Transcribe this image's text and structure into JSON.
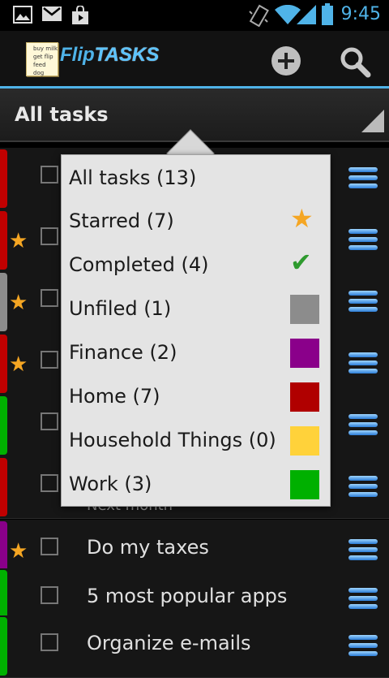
{
  "status_bar": {
    "time": "9:45",
    "icons": [
      "gallery-icon",
      "gmail-icon",
      "market-icon",
      "vibrate-icon",
      "wifi-icon",
      "signal-icon",
      "battery-icon"
    ]
  },
  "app_bar": {
    "logo_flip": "Flip",
    "logo_tasks": "TASKS",
    "logo_note_lines": [
      "buy milk",
      "get flip",
      "feed dog"
    ],
    "add_icon": "add-icon",
    "search_icon": "search-icon"
  },
  "filter_bar": {
    "title": "All tasks"
  },
  "rows": [
    {
      "bar_color": "#c00000",
      "starred": false,
      "title": ""
    },
    {
      "bar_color": "#c00000",
      "starred": true,
      "title": ""
    },
    {
      "bar_color": "#8c8c8c",
      "starred": true,
      "title": ""
    },
    {
      "bar_color": "#c00000",
      "starred": true,
      "title": ""
    },
    {
      "bar_color": "#00b000",
      "starred": false,
      "title": ""
    },
    {
      "bar_color": "#c00000",
      "starred": false,
      "title": ""
    },
    {
      "bar_color": "#8a008a",
      "starred": true,
      "title": "Do my taxes"
    },
    {
      "bar_color": "#00b000",
      "starred": false,
      "title": "5 most popular apps"
    },
    {
      "bar_color": "#00b000",
      "starred": false,
      "title": "Organize e-mails"
    }
  ],
  "hidden_text": "Next month",
  "popup": {
    "items": [
      {
        "label": "All tasks (13)",
        "kind": "none"
      },
      {
        "label": "Starred (7)",
        "kind": "star",
        "icon": "star-icon",
        "color": "#f5a623"
      },
      {
        "label": "Completed (4)",
        "kind": "check",
        "icon": "check-icon",
        "color": "#2e9a2e"
      },
      {
        "label": "Unfiled (1)",
        "kind": "swatch",
        "color": "#8c8c8c"
      },
      {
        "label": "Finance (2)",
        "kind": "swatch",
        "color": "#8a008a"
      },
      {
        "label": "Home (7)",
        "kind": "swatch",
        "color": "#b00000"
      },
      {
        "label": "Household Things (0)",
        "kind": "swatch",
        "color": "#ffd23a"
      },
      {
        "label": "Work (3)",
        "kind": "swatch",
        "color": "#00b000"
      }
    ]
  }
}
